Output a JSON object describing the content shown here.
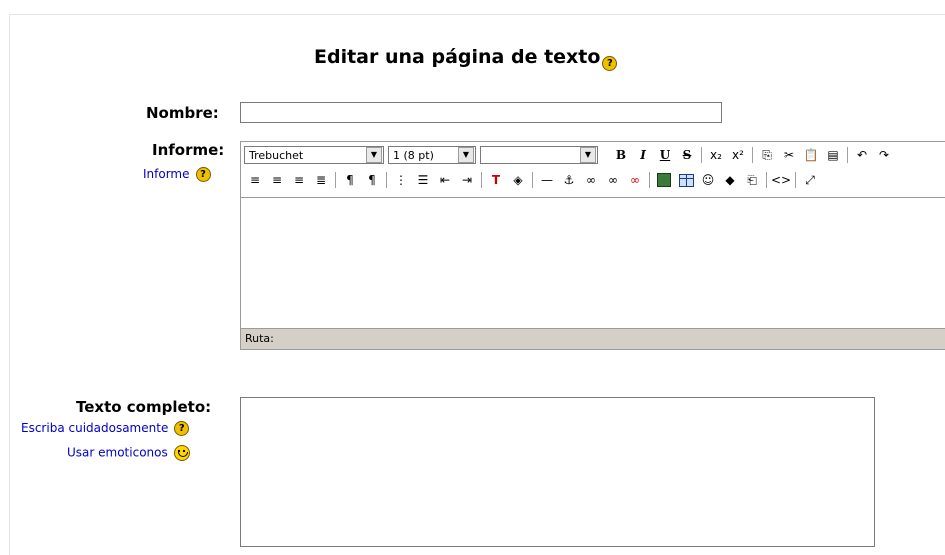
{
  "page": {
    "title": "Editar una página de texto",
    "title_help": "?"
  },
  "fields": {
    "name_label": "Nombre:",
    "name_value": "",
    "report_label": "Informe:",
    "report_link": "Informe",
    "fulltext_label": "Texto completo:",
    "fulltext_link1": "Escriba cuidadosamente",
    "fulltext_link2": "Usar emoticonos"
  },
  "editor": {
    "font_select": "Trebuchet",
    "size_select": "1 (8 pt)",
    "format_select": "",
    "path_label": "Ruta:",
    "toolbar_row1": [
      {
        "name": "bold-button",
        "label": "B"
      },
      {
        "name": "italic-button",
        "label": "I"
      },
      {
        "name": "underline-button",
        "label": "U"
      },
      {
        "name": "strikethrough-button",
        "label": "S"
      },
      {
        "name": "subscript-button",
        "label": "x₂"
      },
      {
        "name": "superscript-button",
        "label": "x²"
      },
      {
        "name": "copy-button",
        "label": "⎘"
      },
      {
        "name": "cut-button",
        "label": "✂"
      },
      {
        "name": "paste-button",
        "label": "📋"
      },
      {
        "name": "paste-word-button",
        "label": "▤"
      },
      {
        "name": "undo-button",
        "label": "↶"
      },
      {
        "name": "redo-button",
        "label": "↷"
      }
    ],
    "toolbar_row2": [
      {
        "name": "align-left-button",
        "label": "≡"
      },
      {
        "name": "align-center-button",
        "label": "≡"
      },
      {
        "name": "align-right-button",
        "label": "≡"
      },
      {
        "name": "justify-button",
        "label": "≣"
      },
      {
        "name": "ltr-button",
        "label": "¶"
      },
      {
        "name": "rtl-button",
        "label": "¶"
      },
      {
        "name": "ordered-list-button",
        "label": "⋮"
      },
      {
        "name": "unordered-list-button",
        "label": "☰"
      },
      {
        "name": "outdent-button",
        "label": "⇤"
      },
      {
        "name": "indent-button",
        "label": "⇥"
      },
      {
        "name": "text-color-button",
        "label": "T"
      },
      {
        "name": "bg-color-button",
        "label": "◈"
      },
      {
        "name": "horizontal-rule-button",
        "label": "—"
      },
      {
        "name": "anchor-button",
        "label": "⚓"
      },
      {
        "name": "link-button",
        "label": "∞"
      },
      {
        "name": "unlink-button",
        "label": "∞"
      },
      {
        "name": "nolink-button",
        "label": "∞"
      },
      {
        "name": "insert-image-button",
        "label": ""
      },
      {
        "name": "insert-table-button",
        "label": ""
      },
      {
        "name": "emoticon-button",
        "label": "☺"
      },
      {
        "name": "special-char-button",
        "label": "◆"
      },
      {
        "name": "search-replace-button",
        "label": "⎗"
      },
      {
        "name": "html-source-button",
        "label": "<>"
      },
      {
        "name": "fullscreen-button",
        "label": "⤢"
      }
    ]
  },
  "colors": {
    "link": "#0000cc",
    "help_icon": "#f0c000",
    "path_bar": "#d4d0c8"
  }
}
